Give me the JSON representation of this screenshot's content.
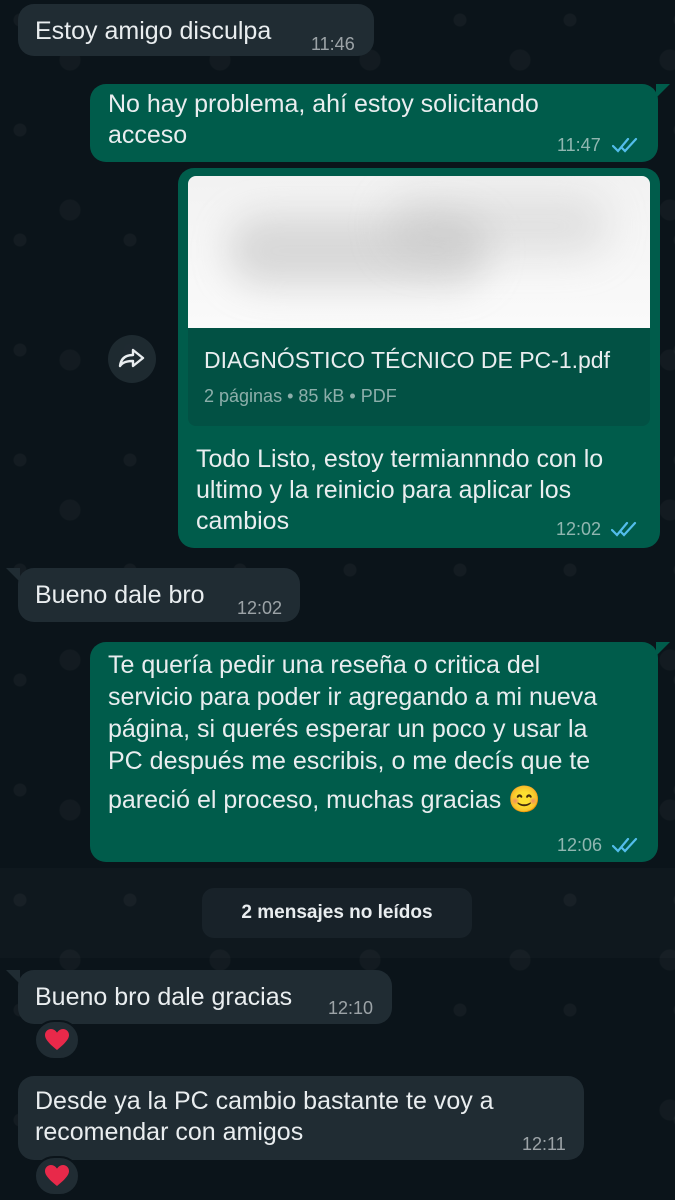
{
  "colors": {
    "background": "#0b141a",
    "incoming_bubble": "#202c33",
    "outgoing_bubble": "#005c4b",
    "read_ticks": "#53bdeb"
  },
  "messages": [
    {
      "direction": "in",
      "text": "Estoy amigo disculpa",
      "time": "11:46"
    },
    {
      "direction": "out",
      "text_lines": [
        "No hay problema, ahí estoy solicitando",
        "acceso"
      ],
      "time": "11:47",
      "status": "read"
    },
    {
      "direction": "out",
      "document": {
        "name": "DIAGNÓSTICO TÉCNICO DE PC-1.pdf",
        "meta": "2 páginas • 85 kB • PDF",
        "forward_icon": "forward-icon"
      },
      "text_lines": [
        "Todo Listo, estoy termiannndo con lo",
        "ultimo y la reinicio para aplicar los",
        "cambios"
      ],
      "time": "12:02",
      "status": "read"
    },
    {
      "direction": "in",
      "text": "Bueno dale bro",
      "time": "12:02"
    },
    {
      "direction": "out",
      "text_lines": [
        "Te quería  pedir una reseña o critica del",
        "servicio para poder ir agregando a mi nueva",
        "página, si querés esperar un poco y usar la",
        "PC después me escribis, o me decís que te",
        "pareció el proceso, muchas gracias"
      ],
      "emoji": "😊",
      "time": "12:06",
      "status": "read"
    },
    {
      "direction": "in",
      "text": "Bueno bro dale gracias",
      "time": "12:10",
      "reaction": "heart"
    },
    {
      "direction": "in",
      "text_lines": [
        "Desde ya la PC cambio bastante te voy a",
        "recomendar con amigos"
      ],
      "time": "12:11",
      "reaction": "heart"
    }
  ],
  "unread_divider": "2 mensajes no leídos"
}
